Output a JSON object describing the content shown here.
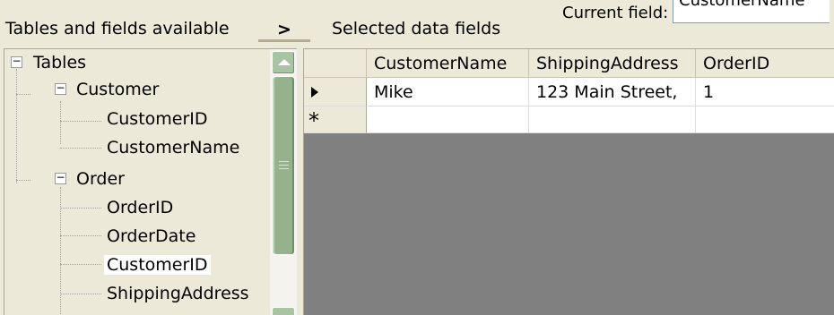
{
  "header": {
    "left_label": "Tables and fields available",
    "move_button_label": ">",
    "right_label": "Selected data fields",
    "current_field_label": "Current field:",
    "current_field_value": "CustomerName"
  },
  "tree": {
    "root": "Tables",
    "tables": [
      {
        "name": "Customer",
        "fields": [
          "CustomerID",
          "CustomerName"
        ]
      },
      {
        "name": "Order",
        "fields": [
          "OrderID",
          "OrderDate",
          "CustomerID",
          "ShippingAddress"
        ]
      }
    ],
    "selected_item": "Order.CustomerID",
    "toggle_glyph": "−"
  },
  "grid": {
    "columns": [
      "CustomerName",
      "ShippingAddress",
      "OrderID"
    ],
    "rows": [
      {
        "marker": "current",
        "cells": [
          "Mike",
          "123 Main Street,",
          "1"
        ]
      },
      {
        "marker": "new",
        "cells": [
          "",
          "",
          ""
        ]
      }
    ],
    "new_row_glyph": "*"
  },
  "colors": {
    "window_bg": "#ece9d8",
    "grid_background": "#808080",
    "scrollbar_accent": "#95b28d"
  }
}
